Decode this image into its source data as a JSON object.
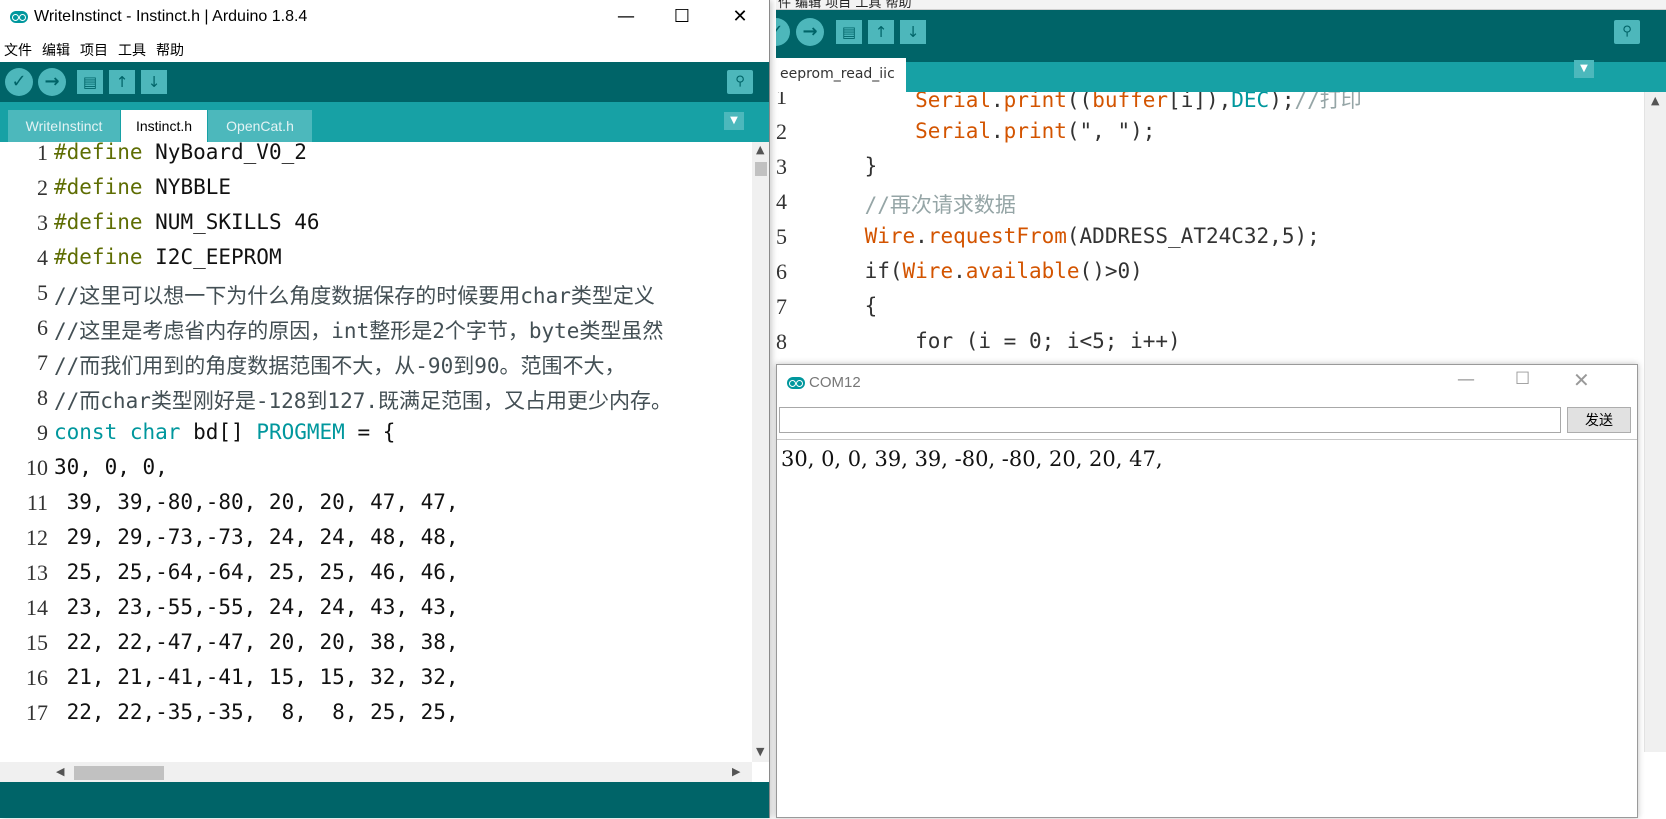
{
  "right_window": {
    "tab_label": "eeprom_read_iic",
    "lines": [
      {
        "num": "1",
        "indent": "        ",
        "parts": [
          [
            "o",
            "Serial"
          ],
          [
            "p",
            "."
          ],
          [
            "o",
            "print"
          ],
          [
            "p",
            "(("
          ],
          [
            "o",
            "buffer"
          ],
          [
            "p",
            "[i]),"
          ],
          [
            "t",
            "DEC"
          ],
          [
            "p",
            ");"
          ],
          [
            "c",
            "//打印"
          ]
        ]
      },
      {
        "num": "2",
        "indent": "        ",
        "parts": [
          [
            "o",
            "Serial"
          ],
          [
            "p",
            "."
          ],
          [
            "o",
            "print"
          ],
          [
            "p",
            "(\", \");"
          ]
        ]
      },
      {
        "num": "3",
        "indent": "    ",
        "parts": [
          [
            "p",
            "}"
          ]
        ]
      },
      {
        "num": "4",
        "indent": "    ",
        "parts": [
          [
            "c",
            "//再次请求数据"
          ]
        ]
      },
      {
        "num": "5",
        "indent": "    ",
        "parts": [
          [
            "o",
            "Wire"
          ],
          [
            "p",
            "."
          ],
          [
            "o",
            "requestFrom"
          ],
          [
            "p",
            "(ADDRESS_AT24C32,5);"
          ]
        ]
      },
      {
        "num": "6",
        "indent": "    ",
        "parts": [
          [
            "p",
            "if("
          ],
          [
            "o",
            "Wire"
          ],
          [
            "p",
            "."
          ],
          [
            "o",
            "available"
          ],
          [
            "p",
            "()>0)"
          ]
        ]
      },
      {
        "num": "7",
        "indent": "    ",
        "parts": [
          [
            "p",
            "{"
          ]
        ]
      },
      {
        "num": "8",
        "indent": "        ",
        "parts": [
          [
            "p",
            "for (i = 0; i<5; i++)"
          ]
        ]
      }
    ]
  },
  "serial_monitor": {
    "title": "COM12",
    "input_value": "",
    "send_label": "发送",
    "output": "30, 0, 0, 39, 39, -80, -80, 20, 20, 47,"
  },
  "left_window": {
    "title": "WriteInstinct - Instinct.h | Arduino 1.8.4",
    "menu": [
      "文件",
      "编辑",
      "项目",
      "工具",
      "帮助"
    ],
    "tabs": [
      {
        "label": "WriteInstinct",
        "active": false
      },
      {
        "label": "Instinct.h",
        "active": true
      },
      {
        "label": "OpenCat.h",
        "active": false
      }
    ],
    "lines": [
      {
        "num": "1",
        "code": "#define NyBoard_V0_2"
      },
      {
        "num": "2",
        "code": "#define NYBBLE"
      },
      {
        "num": "3",
        "code": "#define NUM_SKILLS 46"
      },
      {
        "num": "4",
        "code": "#define I2C_EEPROM"
      },
      {
        "num": "5",
        "code": "//这里可以想一下为什么角度数据保存的时候要用char类型定义"
      },
      {
        "num": "6",
        "code": "//这里是考虑省内存的原因，int整形是2个字节，byte类型虽然"
      },
      {
        "num": "7",
        "code": "//而我们用到的角度数据范围不大，从-90到90。范围不大，"
      },
      {
        "num": "8",
        "code": "//而char类型刚好是-128到127.既满足范围，又占用更少内存。"
      },
      {
        "num": "9",
        "code": "const char bd[] PROGMEM = {"
      },
      {
        "num": "10",
        "code": "30, 0, 0,"
      },
      {
        "num": "11",
        "code": " 39, 39,-80,-80, 20, 20, 47, 47,"
      },
      {
        "num": "12",
        "code": " 29, 29,-73,-73, 24, 24, 48, 48,"
      },
      {
        "num": "13",
        "code": " 25, 25,-64,-64, 25, 25, 46, 46,"
      },
      {
        "num": "14",
        "code": " 23, 23,-55,-55, 24, 24, 43, 43,"
      },
      {
        "num": "15",
        "code": " 22, 22,-47,-47, 20, 20, 38, 38,"
      },
      {
        "num": "16",
        "code": " 21, 21,-41,-41, 15, 15, 32, 32,"
      },
      {
        "num": "17",
        "code": " 22, 22,-35,-35,  8,  8, 25, 25,"
      }
    ]
  },
  "colors": {
    "toolbar": "#006468",
    "tabbar": "#17a1a5",
    "keyword_orange": "#d35400",
    "keyword_teal": "#00979d",
    "comment": "#95a5a6"
  }
}
